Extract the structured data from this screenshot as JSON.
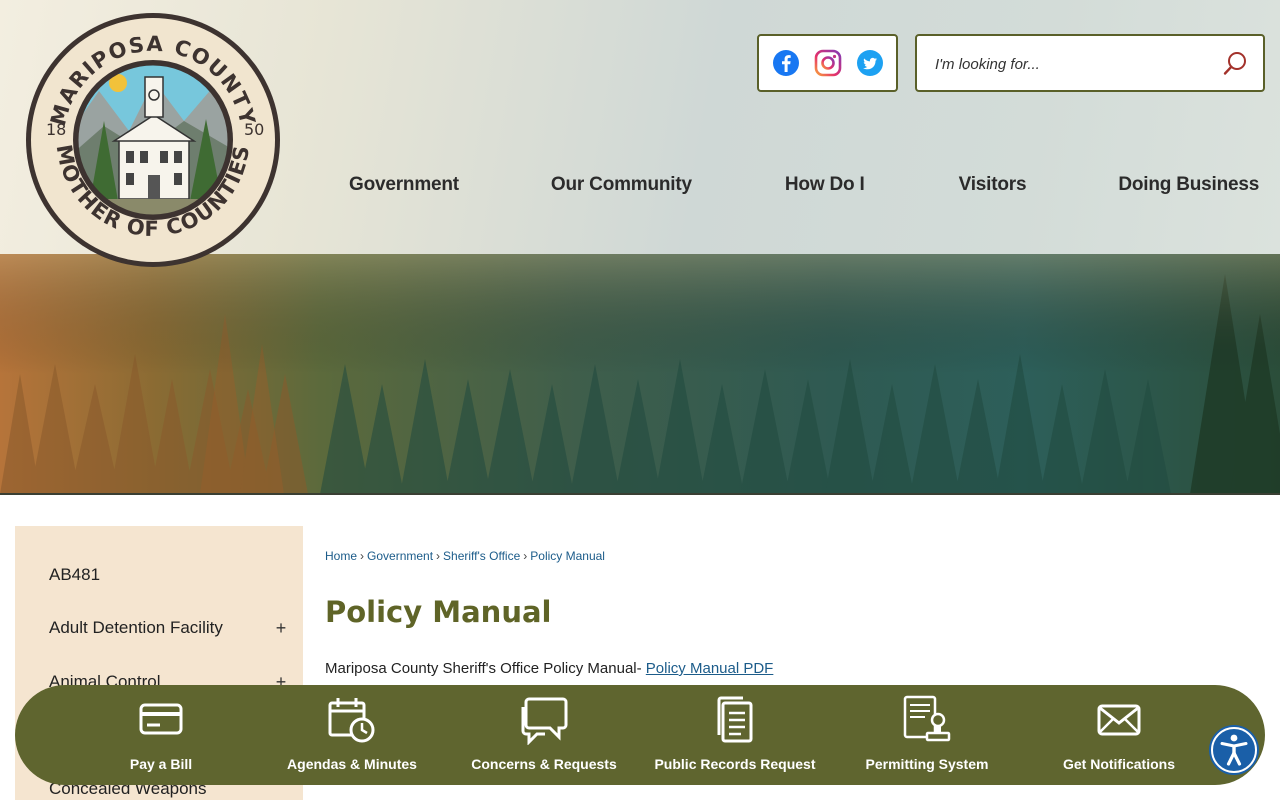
{
  "logo": {
    "top_text": "MARIPOSA COUNTY",
    "bottom_text": "MOTHER OF COUNTIES",
    "year_left": "18",
    "year_right": "50"
  },
  "social": [
    "facebook-icon",
    "instagram-icon",
    "twitter-icon"
  ],
  "search": {
    "placeholder": "I'm looking for..."
  },
  "nav": {
    "items": [
      "Government",
      "Our Community",
      "How Do I",
      "Visitors",
      "Doing Business"
    ]
  },
  "sidebar": {
    "items": [
      {
        "label": "AB481",
        "expandable": false
      },
      {
        "label": "Adult Detention Facility",
        "expandable": true,
        "toggle": "+"
      },
      {
        "label": "Animal Control",
        "expandable": true,
        "toggle": "+"
      },
      {
        "label": "Concealed Weapons",
        "expandable": false
      }
    ]
  },
  "breadcrumb": {
    "items": [
      "Home",
      "Government",
      "Sheriff's Office",
      "Policy Manual"
    ],
    "separator": "›"
  },
  "page": {
    "title": "Policy Manual",
    "intro_text": "Mariposa County Sheriff's Office Policy Manual-",
    "intro_link": "Policy Manual PDF"
  },
  "quick_links": [
    {
      "label": "Pay a Bill",
      "icon": "credit-card-icon"
    },
    {
      "label": "Agendas & Minutes",
      "icon": "calendar-clock-icon"
    },
    {
      "label": "Concerns & Requests",
      "icon": "chat-bubbles-icon"
    },
    {
      "label": "Public Records Request",
      "icon": "documents-icon"
    },
    {
      "label": "Permitting System",
      "icon": "permit-stamp-icon"
    },
    {
      "label": "Get Notifications",
      "icon": "envelope-icon"
    }
  ],
  "accessibility": {
    "icon": "accessibility-icon"
  },
  "colors": {
    "olive": "#5f652f",
    "title": "#5f6427",
    "link": "#1c5c8a",
    "sidebar_bg": "#f5e5d0",
    "accessibility_blue": "#1a5fa8"
  }
}
